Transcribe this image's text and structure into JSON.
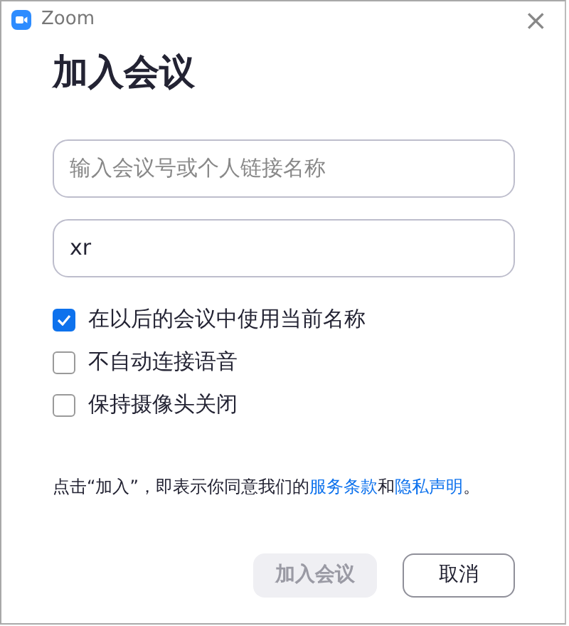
{
  "window": {
    "title": "Zoom",
    "close": "×"
  },
  "heading": "加入会议",
  "fields": [
    {
      "placeholder": "输入会议号或个人链接名称"
    },
    {
      "value": "xr"
    }
  ],
  "options": [
    {
      "label": "在以后的会议中使用当前名称",
      "checked": true
    },
    {
      "label": "不自动连接语音",
      "checked": false
    },
    {
      "label": "保持摄像头关闭",
      "checked": false
    }
  ],
  "terms": {
    "before": "点击“加入”，即表示你同意我们的",
    "link_1": "服务条款",
    "middle": "和",
    "link_2": "隐私声明",
    "after": "。"
  },
  "buttons": [
    {
      "label": "加入会议",
      "kind": "primary",
      "disabled": true
    },
    {
      "label": "取消",
      "kind": "secondary",
      "disabled": false
    }
  ]
}
